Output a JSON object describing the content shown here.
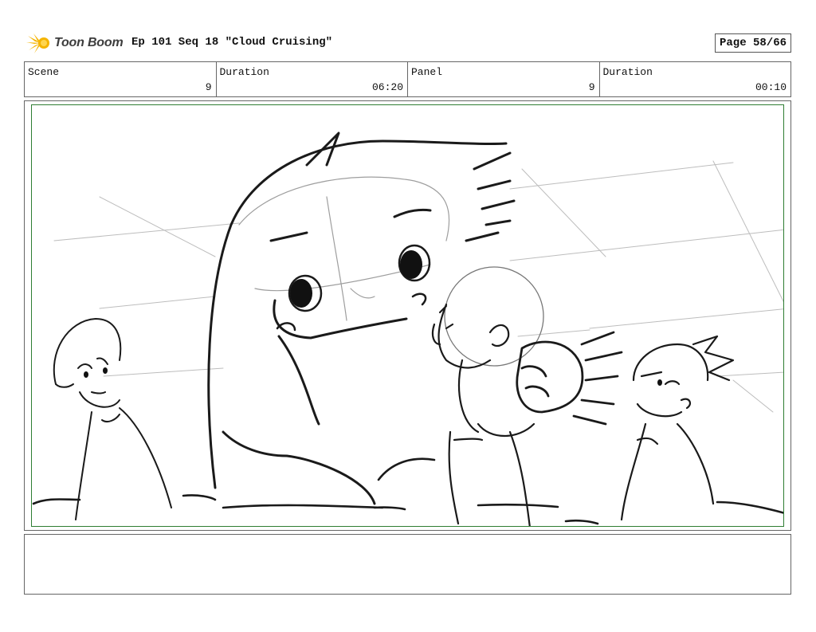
{
  "header": {
    "logo_text": "Toon Boom",
    "sequence_title": "Ep 101 Seq 18 \"Cloud Cruising\"",
    "page_label": "Page 58/66"
  },
  "info": {
    "scene_label": "Scene",
    "scene_value": "9",
    "duration_label": "Duration",
    "duration_value": "06:20",
    "panel_label": "Panel",
    "panel_value": "9",
    "panel_duration_label": "Duration",
    "panel_duration_value": "00:10"
  },
  "panel": {
    "frame_color": "#2e7d32"
  },
  "notes": {
    "text": ""
  }
}
